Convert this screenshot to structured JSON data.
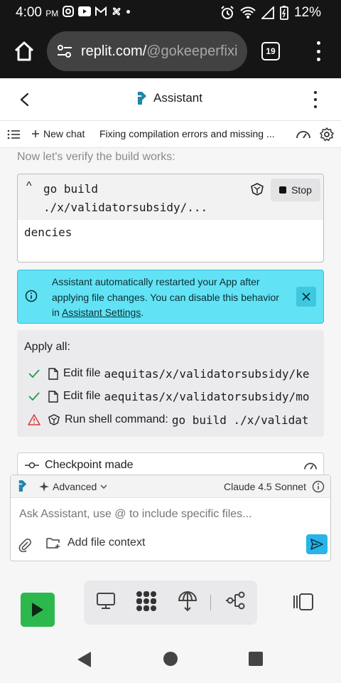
{
  "status_bar": {
    "time": "4:00",
    "ampm": "PM",
    "battery": "12%"
  },
  "browser": {
    "url_host": "replit.com/",
    "url_path": "@gokeeperfixi",
    "tab_count": "19"
  },
  "header": {
    "title": "Assistant"
  },
  "chat_bar": {
    "new_chat_label": "New chat",
    "chat_title": "Fixing compilation errors and missing ..."
  },
  "message": {
    "text": "Now let's verify the build works:"
  },
  "command_card": {
    "command_line1": "go build",
    "command_line2": "./x/validatorsubsidy/...",
    "stop_label": "Stop",
    "output": "dencies"
  },
  "info_banner": {
    "text_before": "Assistant automatically restarted your App after applying file changes. You can disable this behavior in ",
    "link_text": "Assistant Settings",
    "text_after": "."
  },
  "apply_card": {
    "title": "Apply all:",
    "items": [
      {
        "status": "success",
        "label": "Edit file",
        "target": "aequitas/x/validatorsubsidy/ke"
      },
      {
        "status": "success",
        "label": "Edit file",
        "target": "aequitas/x/validatorsubsidy/mo"
      },
      {
        "status": "warning",
        "label": "Run shell command:",
        "target": "go build ./x/validat"
      }
    ]
  },
  "checkpoint": {
    "label": "Checkpoint made"
  },
  "composer": {
    "mode_label": "Advanced",
    "model_label": "Claude 4.5 Sonnet",
    "placeholder": "Ask Assistant, use @ to include specific files...",
    "file_context_label": "Add file context"
  },
  "colors": {
    "run_green": "#2db84e",
    "info_cyan": "#62e3f5",
    "send_blue": "#28b4e8",
    "success_green": "#1f9d48",
    "warning_red": "#d63b3b"
  }
}
